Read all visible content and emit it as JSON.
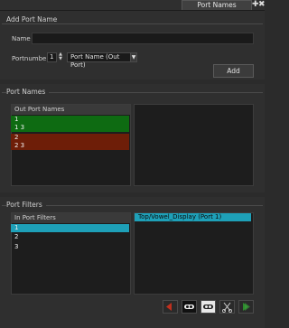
{
  "window": {
    "tab_title": "Port Names"
  },
  "add_port_name": {
    "section_title": "Add Port Name",
    "name_label": "Name",
    "name_value": "",
    "portnumber_label": "Portnumber",
    "portnumber_value": "1",
    "port_type_value": "Port Name (Out Port)",
    "add_button": "Add"
  },
  "port_names": {
    "section_title": "Port Names",
    "list_header": "Out Port Names",
    "items": [
      {
        "label": "1",
        "color": "#0e6b12"
      },
      {
        "label": "1 3",
        "color": "#0e6b12"
      },
      {
        "label": "2",
        "color": "#6e1e08"
      },
      {
        "label": "2 3",
        "color": "#6e1e08"
      }
    ]
  },
  "port_filters": {
    "section_title": "Port Filters",
    "list_header": "In Port Filters",
    "items": [
      {
        "label": "1",
        "selected": true
      },
      {
        "label": "2",
        "selected": false
      },
      {
        "label": "3",
        "selected": false
      }
    ],
    "assigned_items": [
      {
        "label": "Top/Vowel_Display (Port 1)",
        "selected": true
      }
    ]
  },
  "colors": {
    "selection": "#1ea0b8",
    "green": "#0e6b12",
    "red": "#6e1e08"
  },
  "toolbar": {
    "icons": [
      "red-arrow-icon",
      "mask-icon",
      "mask-white-icon",
      "cut-icon",
      "green-arrow-icon"
    ]
  }
}
